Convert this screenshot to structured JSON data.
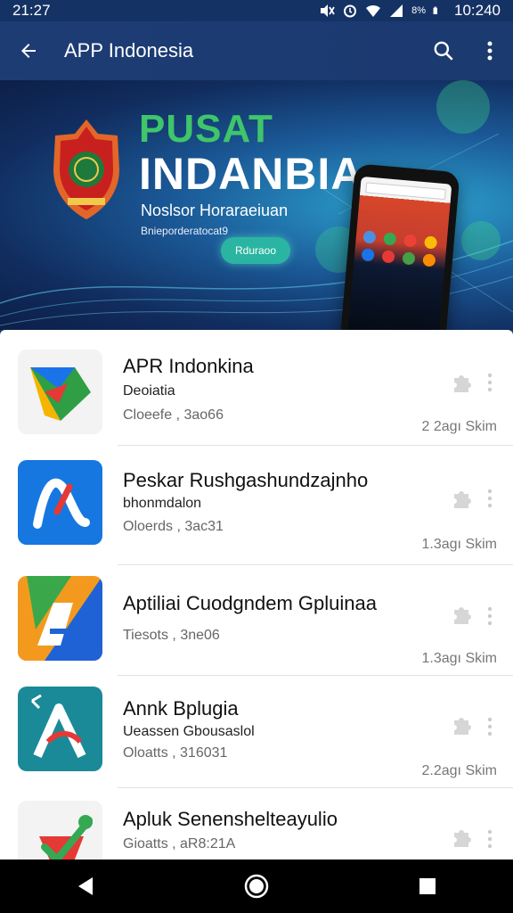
{
  "status_bar": {
    "time_left": "21:27",
    "battery": "8%",
    "time_right": "10:240"
  },
  "app_bar": {
    "title": "APP Indonesia"
  },
  "hero": {
    "title_line1": "PUSAT",
    "title_line2": "INDANBIA",
    "subtitle": "Noslsor Horaraeiuan",
    "subtitle_small": "Bnieporderatocat9",
    "button_label": "Rduraoo"
  },
  "apps": [
    {
      "name": "APR Indonkina",
      "subtitle": "Deoiatia",
      "meta": "Cloeefe , 3ao66",
      "size": "2 2agı Skim"
    },
    {
      "name": "Peskar Rushgashundzajnho",
      "subtitle": "bhonmdalon",
      "meta": "Oloerds , 3ac31",
      "size": "1.3agı Skim"
    },
    {
      "name": "Aptiliai Cuodgndem Gpluinaa",
      "subtitle": "",
      "meta": "Tiesots , 3ne06",
      "size": "1.3agı Skim"
    },
    {
      "name": "Annk Bplugia",
      "subtitle": "Ueassen Gbousaslol",
      "meta": "Oloatts , 316031",
      "size": "2.2agı Skim"
    },
    {
      "name": "Apluk Senenshelteayulio",
      "subtitle": "",
      "meta": "Gioatts , aR8:21A",
      "size": ""
    }
  ],
  "icons": {
    "back": "arrow-left-icon",
    "search": "search-icon",
    "menu": "more-vert-icon",
    "puzzle": "puzzle-icon",
    "nav_back": "triangle-back-icon",
    "nav_home": "circle-home-icon",
    "nav_recent": "square-recent-icon"
  },
  "colors": {
    "app_bar": "#1d3c74",
    "hero_green": "#3fc56a",
    "hero_button": "#2ab5a2",
    "list_bg": "#ffffff"
  }
}
